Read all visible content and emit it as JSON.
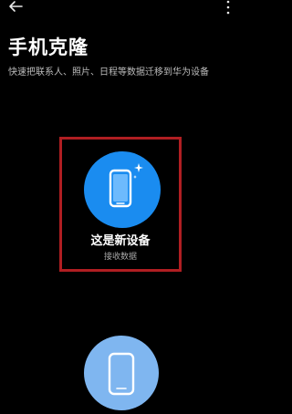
{
  "header": {
    "back_icon": "arrow-left-icon",
    "more_icon": "more-vertical-icon",
    "title": "手机克隆",
    "subtitle": "快速把联系人、照片、日程等数据迁移到华为设备"
  },
  "options": {
    "new_device": {
      "label": "这是新设备",
      "sublabel": "接收数据",
      "icon": "phone-sparkle-icon",
      "color": "#1a8cf0"
    },
    "old_device": {
      "icon": "phone-icon",
      "color": "#7fb6f0"
    }
  },
  "highlight_color": "#b01e22"
}
